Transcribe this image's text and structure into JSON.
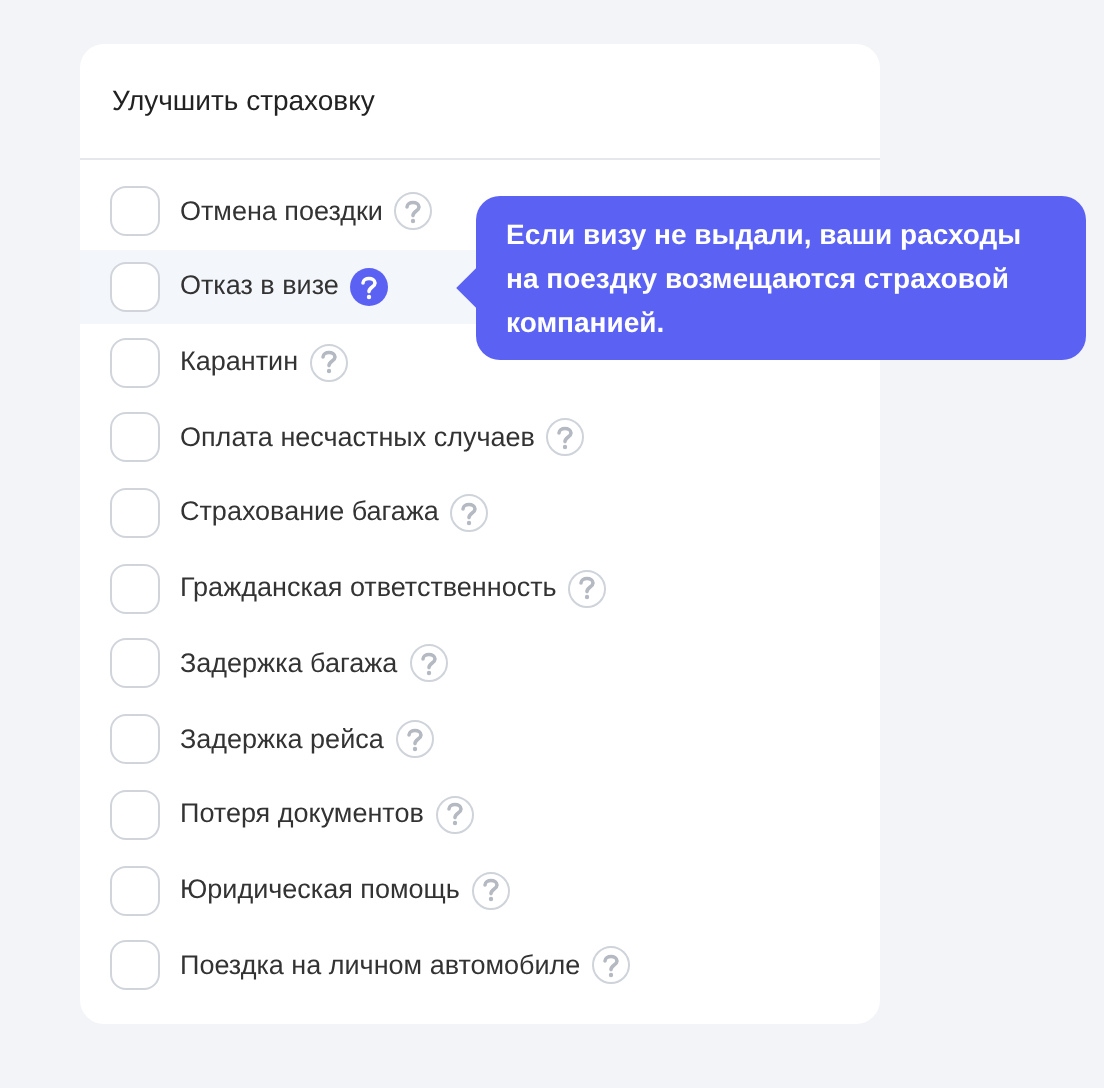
{
  "title": "Улучшить страховку",
  "options": [
    {
      "label": "Отмена поездки",
      "checked": false,
      "hovered": false
    },
    {
      "label": "Отказ в визе",
      "checked": false,
      "hovered": true
    },
    {
      "label": "Карантин",
      "checked": false,
      "hovered": false
    },
    {
      "label": "Оплата несчастных случаев",
      "checked": false,
      "hovered": false
    },
    {
      "label": "Страхование багажа",
      "checked": false,
      "hovered": false
    },
    {
      "label": "Гражданская ответственность",
      "checked": false,
      "hovered": false
    },
    {
      "label": "Задержка багажа",
      "checked": false,
      "hovered": false
    },
    {
      "label": "Задержка рейса",
      "checked": false,
      "hovered": false
    },
    {
      "label": "Потеря документов",
      "checked": false,
      "hovered": false
    },
    {
      "label": "Юридическая помощь",
      "checked": false,
      "hovered": false
    },
    {
      "label": "Поездка на личном автомобиле",
      "checked": false,
      "hovered": false
    }
  ],
  "tooltip": {
    "text": "Если визу не выдали, ваши расходы на поездку возмещаются страховой компанией."
  }
}
